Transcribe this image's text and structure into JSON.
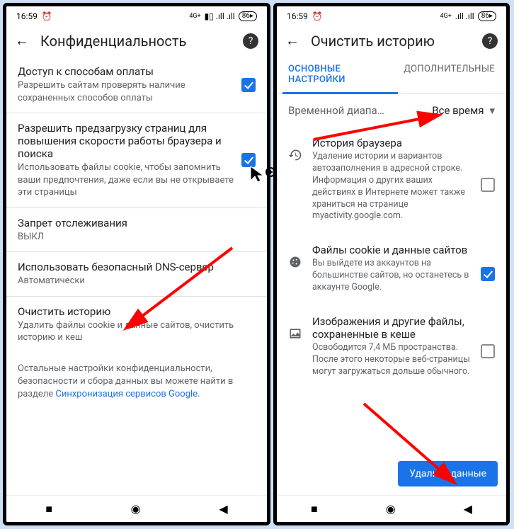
{
  "status": {
    "time": "16:59",
    "alarm": "⏰",
    "net": "4G+",
    "sig": "▮▯",
    "wifi": "…ıl  .ıll",
    "battery": "86"
  },
  "left": {
    "title": "Конфиденциальность",
    "rows": [
      {
        "title": "Доступ к способам оплаты",
        "sub": "Разрешить сайтам проверять наличие сохраненных способов оплаты",
        "checked": true
      },
      {
        "title": "Разрешить предзагрузку страниц для повышения скорости работы браузера и поиска",
        "sub": "Использовать файлы cookie, чтобы запомнить ваши предпочтения, даже если вы не открываете эти страницы",
        "checked": true
      },
      {
        "title": "Запрет отслеживания",
        "sub": "ВЫКЛ"
      },
      {
        "title": "Использовать безопасный DNS-сервер",
        "sub": "Автоматически"
      },
      {
        "title": "Очистить историю",
        "sub": "Удалить файлы cookie и данные сайтов, очистить историю и кеш"
      }
    ],
    "note_pre": "Остальные настройки конфиденциальности, безопасности и сбора данных вы можете найти в разделе ",
    "note_link": "Синхронизация сервисов Google",
    "note_post": "."
  },
  "right": {
    "title": "Очистить историю",
    "tab_basic": "ОСНОВНЫЕ НАСТРОЙКИ",
    "tab_adv": "ДОПОЛНИТЕЛЬНЫЕ",
    "range_label": "Временной диапа…",
    "range_value": "Все время",
    "cats": [
      {
        "title": "История браузера",
        "sub": "Удаление истории и вариантов автозаполнения в адресной строке. Информация о других ваших действиях в Интернете может также храниться на странице myactivity.google.com.",
        "checked": false,
        "icon": "history"
      },
      {
        "title": "Файлы cookie и данные сайтов",
        "sub": "Вы выйдете из аккаунтов на большинстве сайтов, но останетесь в аккаунте Google.",
        "checked": true,
        "icon": "cookie"
      },
      {
        "title": "Изображения и другие файлы, сохраненные в кеше",
        "sub": "Освободится 7,4 МБ пространства. После этого некоторые веб-страницы могут загружаться дольше обычного.",
        "checked": false,
        "icon": "image"
      }
    ],
    "clear_btn": "Удалить данные"
  }
}
